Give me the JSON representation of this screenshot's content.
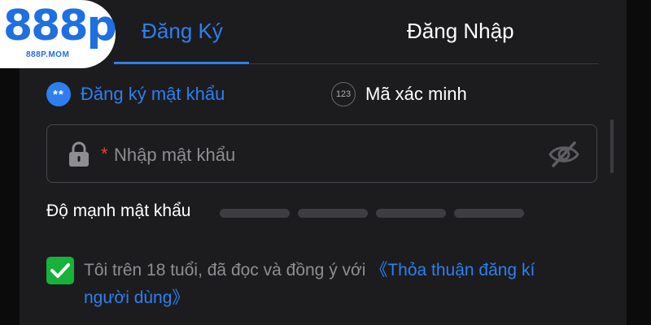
{
  "logo": {
    "main": "888p",
    "sub": "888P.MOM"
  },
  "tabs": {
    "register": "Đăng Ký",
    "login": "Đăng Nhập"
  },
  "methods": {
    "password": {
      "icon_text": "**",
      "label": "Đăng ký mật khẩu"
    },
    "code": {
      "icon_text": "123",
      "label": "Mã xác minh"
    }
  },
  "password_field": {
    "required_mark": "*",
    "placeholder": "Nhập mật khẩu",
    "value": ""
  },
  "strength": {
    "label": "Độ mạnh mật khẩu",
    "segments": 4,
    "level": 0
  },
  "agreement": {
    "checked": true,
    "text": "Tôi trên 18 tuổi, đã đọc và đồng ý với ",
    "link_line1": "《Thỏa thuận đăng kí",
    "link_line2": "người dùng》"
  },
  "colors": {
    "accent": "#2d7ff0",
    "background": "#1c1c1e",
    "checkbox": "#16b23a",
    "required": "#e5413a"
  }
}
